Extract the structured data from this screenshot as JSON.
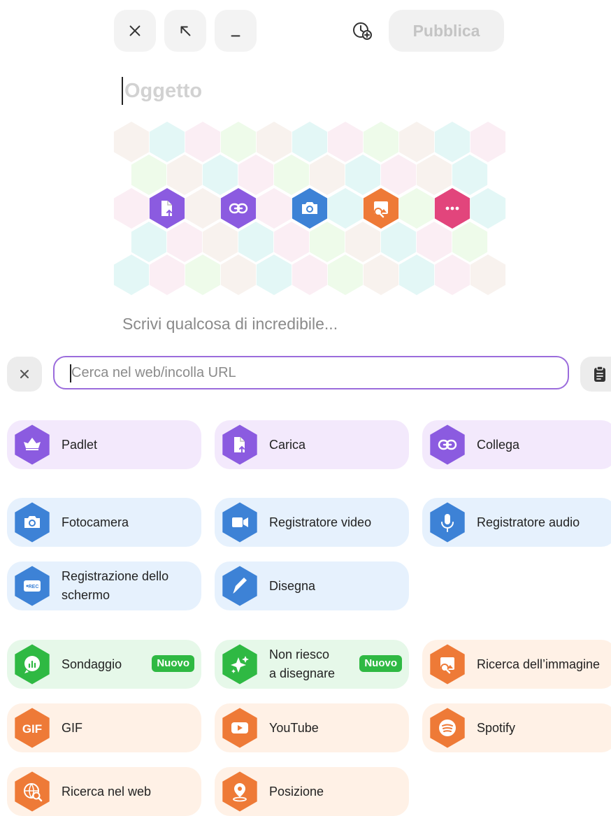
{
  "toolbar": {
    "publish_label": "Pubblica"
  },
  "post": {
    "subject_placeholder": "Oggetto",
    "body_placeholder": "Scrivi qualcosa di incredibile..."
  },
  "quick_attach": [
    {
      "icon": "upload-file-icon",
      "color": "#8b5be0"
    },
    {
      "icon": "link-icon",
      "color": "#8b5be0"
    },
    {
      "icon": "camera-icon",
      "color": "#3d82d6"
    },
    {
      "icon": "image-search-icon",
      "color": "#ee7a37"
    },
    {
      "icon": "more-icon",
      "color": "#e2457c"
    }
  ],
  "search": {
    "placeholder": "Cerca nel web/incolla URL"
  },
  "attachments": [
    {
      "label": "Padlet",
      "icon": "padlet-bird-icon",
      "color": "#8b5be0",
      "group": "purple"
    },
    {
      "label": "Carica",
      "icon": "upload-file-icon",
      "color": "#8b5be0",
      "group": "purple"
    },
    {
      "label": "Collega",
      "icon": "link-icon",
      "color": "#8b5be0",
      "group": "purple"
    },
    {
      "label": "Fotocamera",
      "icon": "camera-icon",
      "color": "#3d82d6",
      "group": "blue"
    },
    {
      "label": "Registratore video",
      "icon": "video-camera-icon",
      "color": "#3d82d6",
      "group": "blue"
    },
    {
      "label": "Registratore audio",
      "icon": "microphone-icon",
      "color": "#3d82d6",
      "group": "blue"
    },
    {
      "label": "Registrazione dello schermo",
      "icon": "screen-record-icon",
      "color": "#3d82d6",
      "group": "blue"
    },
    {
      "label": "Disegna",
      "icon": "paintbrush-icon",
      "color": "#3d82d6",
      "group": "blue"
    },
    {
      "label": "Sondaggio",
      "icon": "poll-icon",
      "color": "#2fb943",
      "group": "green",
      "badge": "Nuovo"
    },
    {
      "label": "Non riesco a disegnare",
      "icon": "sparkles-icon",
      "color": "#2fb943",
      "group": "green",
      "badge": "Nuovo"
    },
    {
      "label": "Ricerca dell’immagine",
      "icon": "image-search-icon",
      "color": "#ee7a37",
      "group": "orange"
    },
    {
      "label": "GIF",
      "icon": "gif-icon",
      "color": "#ee7a37",
      "group": "orange",
      "icon_text": "GIF"
    },
    {
      "label": "YouTube",
      "icon": "youtube-icon",
      "color": "#ee7a37",
      "group": "orange"
    },
    {
      "label": "Spotify",
      "icon": "spotify-icon",
      "color": "#ee7a37",
      "group": "orange"
    },
    {
      "label": "Ricerca nel web",
      "icon": "globe-search-icon",
      "color": "#ee7a37",
      "group": "orange"
    },
    {
      "label": "Posizione",
      "icon": "location-pin-icon",
      "color": "#ee7a37",
      "group": "orange"
    }
  ]
}
